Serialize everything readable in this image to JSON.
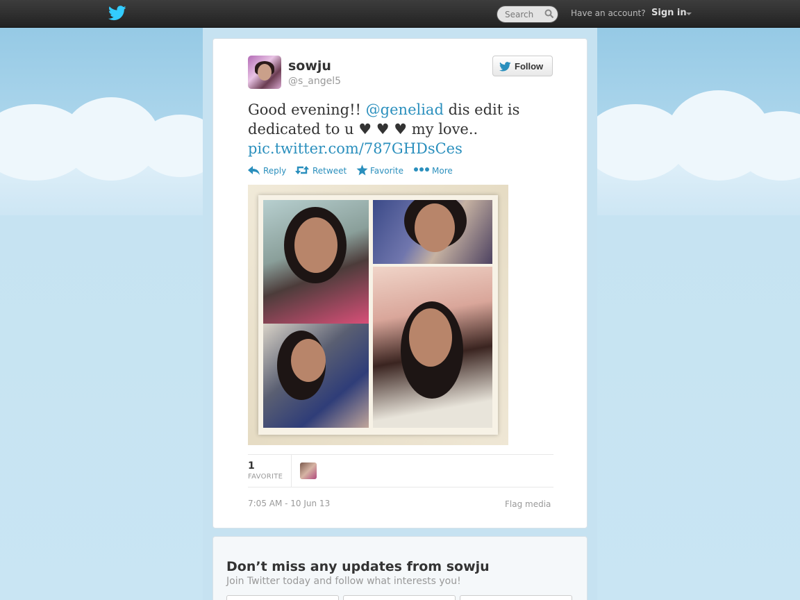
{
  "topbar": {
    "search_placeholder": "Search",
    "account_question": "Have an account?",
    "signin_label": "Sign in"
  },
  "tweet": {
    "author_name": "sowju",
    "author_handle": "@s_angel5",
    "follow_label": "Follow",
    "text_prefix": "Good evening!! ",
    "mention": "@geneliad",
    "text_middle": " dis edit is dedicated to u ♥ ♥ ♥ my love..",
    "media_link": "pic.twitter.com/787GHDsCes",
    "actions": {
      "reply": "Reply",
      "retweet": "Retweet",
      "favorite": "Favorite",
      "more": "More"
    },
    "stats": {
      "favorite_count": "1",
      "favorite_label": "FAVORITE"
    },
    "timestamp": "7:05 AM - 10 Jun 13",
    "flag_label": "Flag media"
  },
  "signup": {
    "title": "Don’t miss any updates from sowju",
    "subtitle": "Join Twitter today and follow what interests you!"
  },
  "colors": {
    "link": "#2a8fbd",
    "topbar": "#2b2b2b",
    "bird": "#33ccff"
  }
}
